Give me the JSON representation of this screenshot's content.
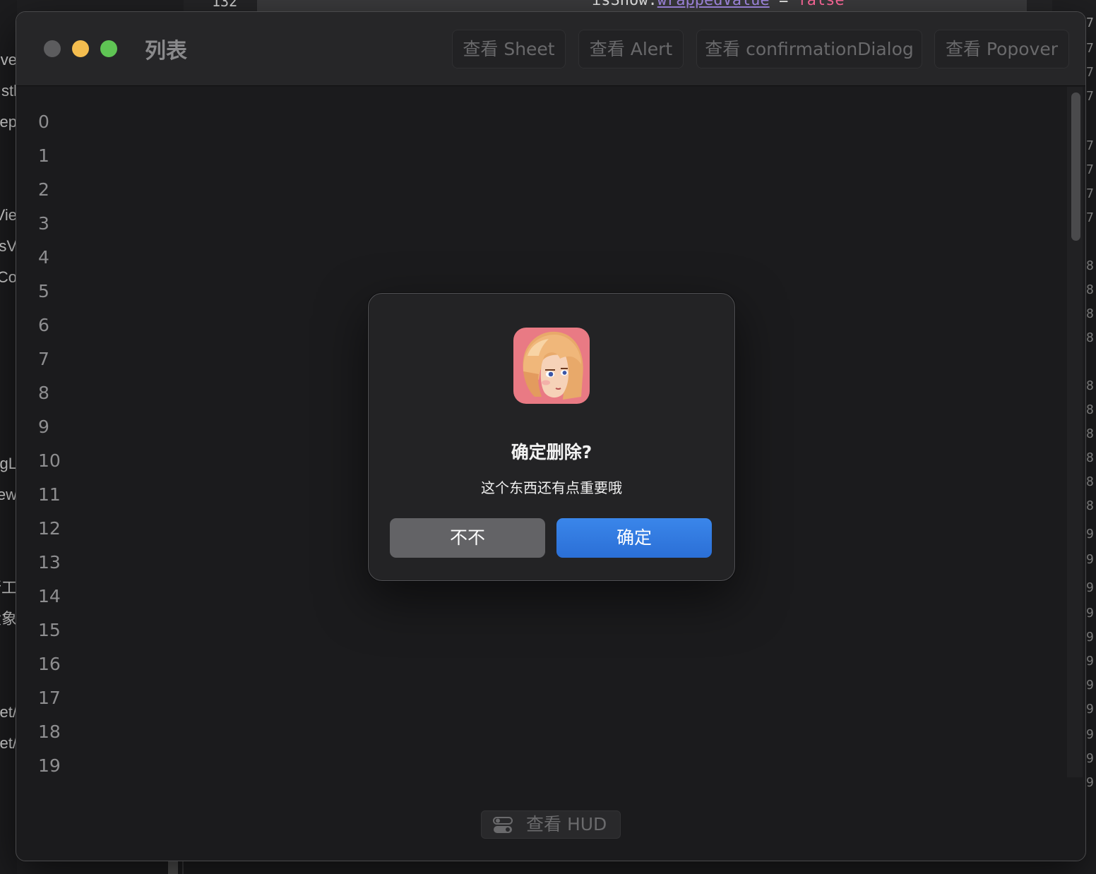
{
  "background": {
    "top_line_number": "132",
    "top_code": {
      "prefix": "isShow",
      "property": "wrappedValue",
      "operator": "=",
      "keyword": "false"
    },
    "left_fragments": [
      "eve",
      "stl",
      "Rep",
      "Vie",
      "sV",
      "Co",
      "gL",
      "ew",
      "行工",
      "大象",
      "et/",
      "et/"
    ],
    "right_fragments": [
      "7",
      "7",
      "7",
      "7",
      "7",
      "7",
      "7",
      "7",
      "8",
      "8",
      "8",
      "8",
      "8",
      "8",
      "8",
      "8",
      "8",
      "8",
      "9",
      "9",
      "9",
      "9",
      "9",
      "9",
      "9",
      "9",
      "9",
      "9",
      "9"
    ]
  },
  "window": {
    "title": "列表",
    "toolbar": {
      "sheet_label": "查看 Sheet",
      "alert_label": "查看 Alert",
      "confirmation_label": "查看 confirmationDialog",
      "popover_label": "查看 Popover"
    },
    "rows": [
      "0",
      "1",
      "2",
      "3",
      "4",
      "5",
      "6",
      "7",
      "8",
      "9",
      "10",
      "11",
      "12",
      "13",
      "14",
      "15",
      "16",
      "17",
      "18",
      "19"
    ],
    "hud_button_label": "查看 HUD"
  },
  "alert": {
    "title": "确定删除?",
    "message": "这个东西还有点重要哦",
    "cancel_label": "不不",
    "confirm_label": "确定",
    "icon": "app-icon-girl-avatar"
  },
  "colors": {
    "confirm_button": "#2f7be0",
    "cancel_button": "#636366",
    "traffic_close": "#5c5c5e",
    "traffic_minimize": "#f4bd4f",
    "traffic_maximize": "#5fc454"
  }
}
